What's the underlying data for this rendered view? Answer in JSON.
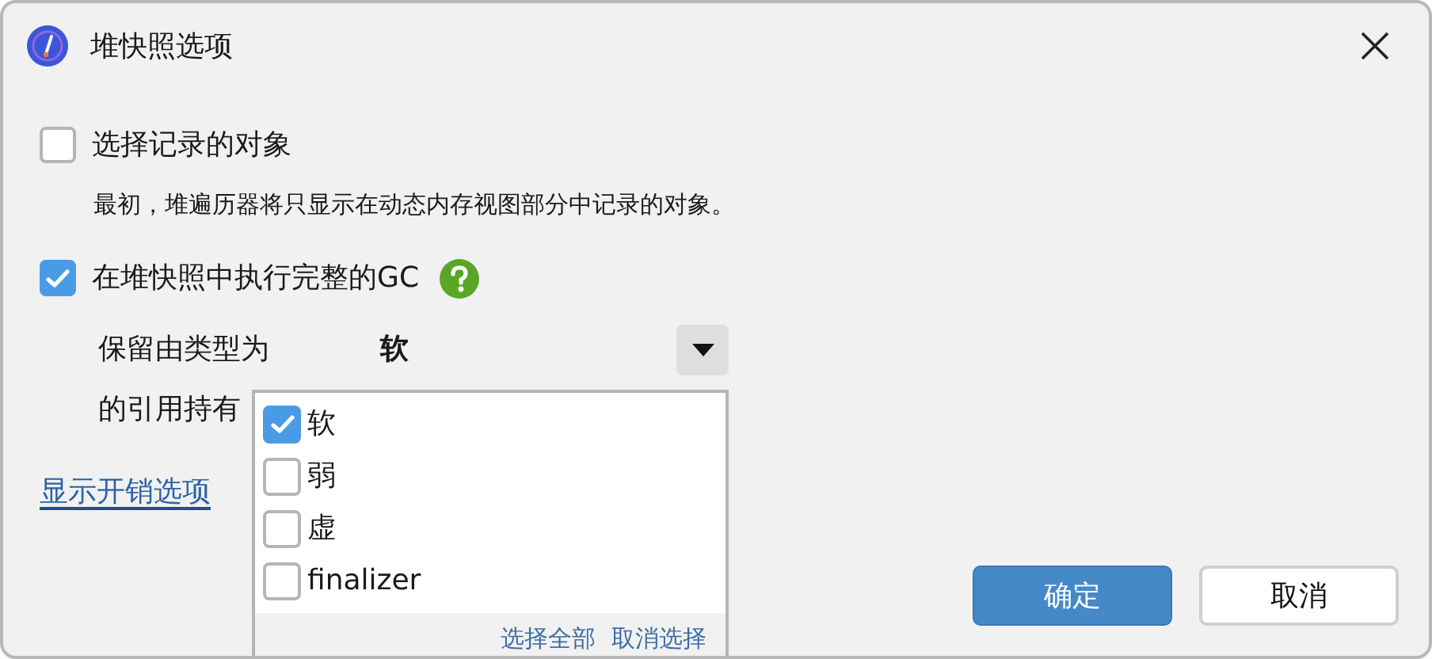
{
  "window": {
    "title": "堆快照选项"
  },
  "options": [
    {
      "label": "选择记录的对象",
      "checked": false,
      "description": "最初，堆遍历器将只显示在动态内存视图部分中记录的对象。"
    },
    {
      "label": "在堆快照中执行完整的GC",
      "checked": true,
      "help": true
    }
  ],
  "retain": {
    "label": "保留由类型为",
    "value": "软",
    "label_2": "的引用持有"
  },
  "dropdown": {
    "items": [
      {
        "label": "软",
        "checked": true
      },
      {
        "label": "弱",
        "checked": false
      },
      {
        "label": "虚",
        "checked": false
      },
      {
        "label": "finalizer",
        "checked": false
      }
    ],
    "footer_links": [
      "选择全部",
      "取消选择"
    ]
  },
  "overhead_link": "显示开销选项",
  "buttons": [
    {
      "label": "确定",
      "kind": "primary"
    },
    {
      "label": "取消",
      "kind": "secondary"
    }
  ]
}
